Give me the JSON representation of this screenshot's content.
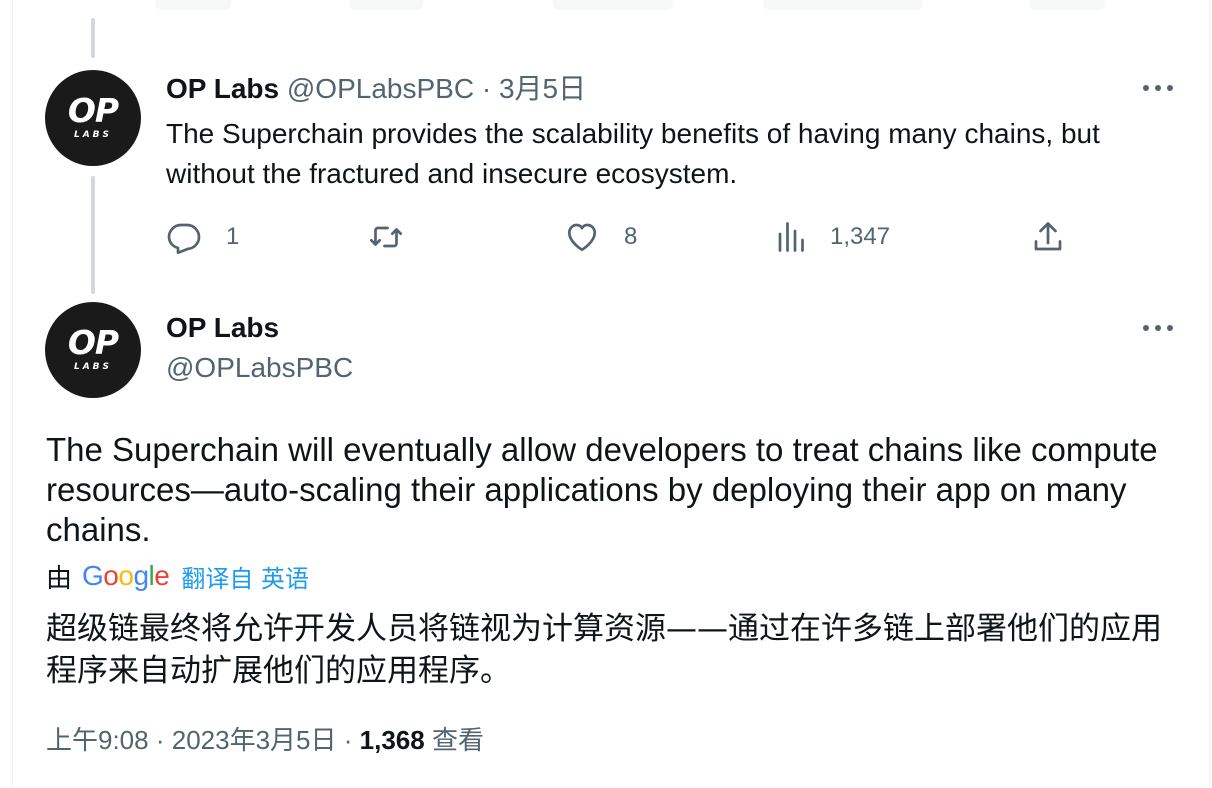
{
  "reply_tweet": {
    "author_name": "OP Labs",
    "author_handle": "@OPLabsPBC",
    "separator": "·",
    "date": "3月5日",
    "text": "The Superchain provides the scalability benefits of having many chains, but without the fractured and insecure ecosystem.",
    "actions": {
      "reply_count": "1",
      "retweet_count": "",
      "like_count": "8",
      "views_count": "1,347"
    }
  },
  "main_tweet": {
    "author_name": "OP Labs",
    "author_handle": "@OPLabsPBC",
    "text": "The Superchain will eventually allow developers to treat chains like compute resources—auto-scaling their applications by deploying their app on many chains.",
    "translation": {
      "by_label": "由",
      "provider": [
        "G",
        "o",
        "o",
        "g",
        "l",
        "e"
      ],
      "translated_from": "翻译自 英语",
      "text": "超级链最终将允许开发人员将链视为计算资源——通过在许多链上部署他们的应用程序来自动扩展他们的应用程序。"
    },
    "time": "上午9:08",
    "separator": "·",
    "full_date": "2023年3月5日",
    "views_count": "1,368",
    "views_label": "查看"
  },
  "avatar": {
    "big": "OP",
    "small": "LABS"
  },
  "icons": {
    "reply": "reply-icon",
    "retweet": "retweet-icon",
    "like": "heart-icon",
    "views": "analytics-icon",
    "share": "share-icon",
    "more": "more-icon"
  },
  "colors": {
    "text": "#0f1419",
    "secondary": "#536471",
    "link": "#1d9bf0",
    "thread_line": "#cfd9de",
    "avatar_bg": "#1a1a1a"
  }
}
